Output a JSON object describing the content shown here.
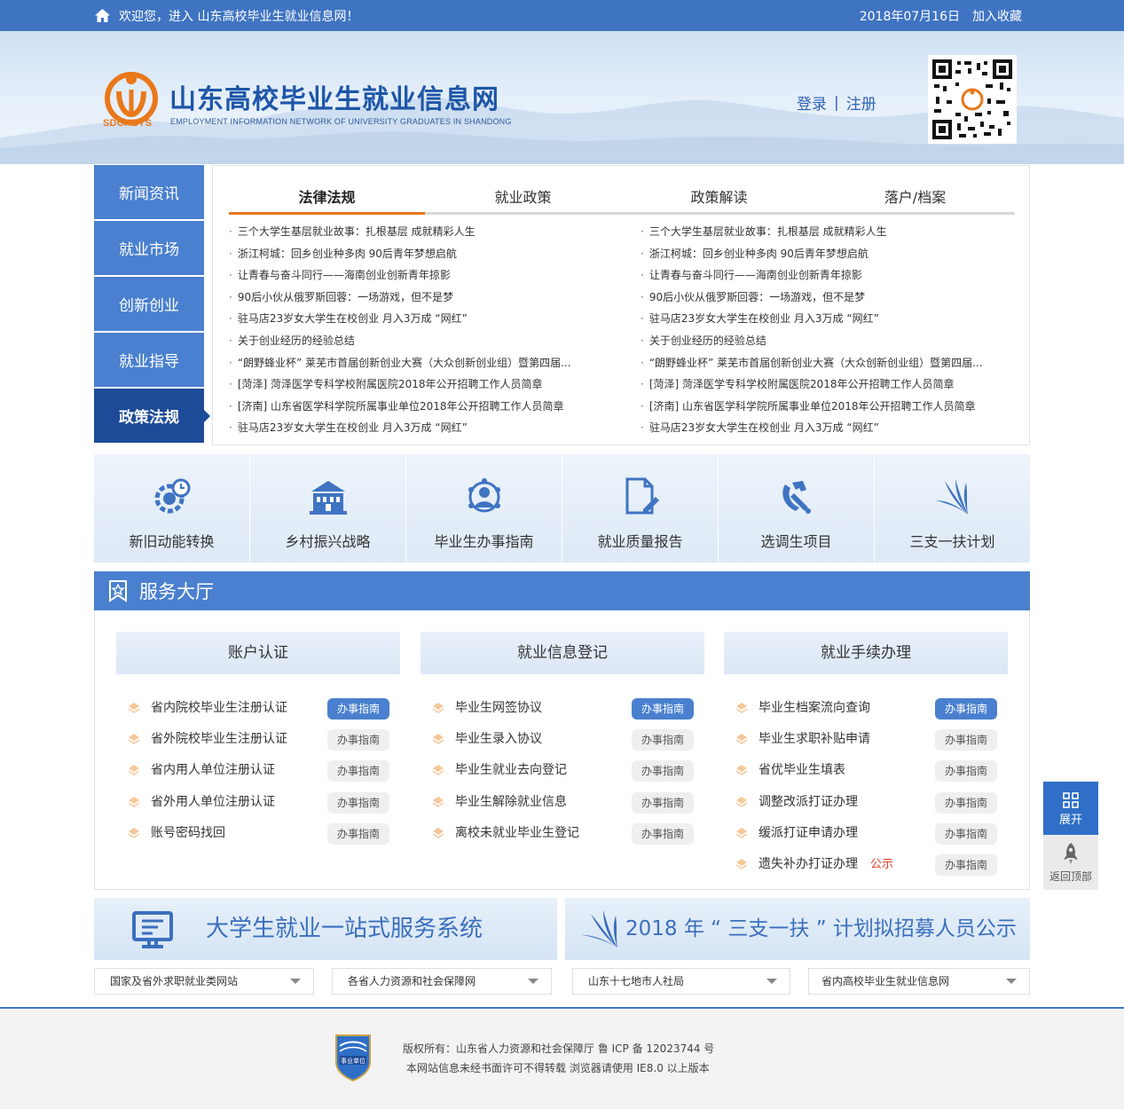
{
  "topbar": {
    "welcome": "欢迎您，进入 山东高校毕业生就业信息网！",
    "date": "2018年07月16日",
    "favorite": "加入收藏"
  },
  "header": {
    "logo_abbr": "SDGXBYS",
    "title": "山东高校毕业生就业信息网",
    "subtitle": "EMPLOYMENT INFORMATION NETWORK OF UNIVERSITY GRADUATES IN SHANDONG",
    "login": "登录",
    "separator": "|",
    "register": "注册"
  },
  "sidenav": [
    {
      "label": "新闻资讯"
    },
    {
      "label": "就业市场"
    },
    {
      "label": "创新创业"
    },
    {
      "label": "就业指导"
    },
    {
      "label": "政策法规",
      "active": true
    }
  ],
  "news": {
    "tabs": [
      "法律法规",
      "就业政策",
      "政策解读",
      "落户/档案"
    ],
    "active_tab": 0,
    "left": [
      "三个大学生基层就业故事：扎根基层 成就精彩人生",
      "浙江柯城：回乡创业种多肉 90后青年梦想启航",
      "让青春与奋斗同行——海南创业创新青年掠影",
      "90后小伙从俄罗斯回蓉：一场游戏，但不是梦",
      "驻马店23岁女大学生在校创业 月入3万成 “网红”",
      "关于创业经历的经验总结",
      "“朗野蜂业杯” 莱芜市首届创新创业大赛（大众创新创业组）暨第四届...",
      "[菏泽] 菏泽医学专科学校附属医院2018年公开招聘工作人员简章",
      "[济南] 山东省医学科学院所属事业单位2018年公开招聘工作人员简章",
      "驻马店23岁女大学生在校创业 月入3万成 “网红”"
    ],
    "right": [
      "三个大学生基层就业故事：扎根基层 成就精彩人生",
      "浙江柯城：回乡创业种多肉 90后青年梦想启航",
      "让青春与奋斗同行——海南创业创新青年掠影",
      "90后小伙从俄罗斯回蓉：一场游戏，但不是梦",
      "驻马店23岁女大学生在校创业 月入3万成 “网红”",
      "关于创业经历的经验总结",
      "“朗野蜂业杯” 莱芜市首届创新创业大赛（大众创新创业组）暨第四届...",
      "[菏泽] 菏泽医学专科学校附属医院2018年公开招聘工作人员简章",
      "[济南] 山东省医学科学院所属事业单位2018年公开招聘工作人员简章",
      "驻马店23岁女大学生在校创业 月入3万成 “网红”"
    ]
  },
  "quick_links": [
    {
      "label": "新旧动能转换",
      "icon": "gear-clock-icon"
    },
    {
      "label": "乡村振兴战略",
      "icon": "building-icon"
    },
    {
      "label": "毕业生办事指南",
      "icon": "people-network-icon"
    },
    {
      "label": "就业质量报告",
      "icon": "document-edit-icon"
    },
    {
      "label": "选调生项目",
      "icon": "party-emblem-icon"
    },
    {
      "label": "三支一扶计划",
      "icon": "leaf-fan-icon"
    }
  ],
  "hall": {
    "title": "服务大厅",
    "guide_label": "办事指南",
    "notice_label": "公示",
    "columns": [
      {
        "title": "账户认证",
        "items": [
          "省内院校毕业生注册认证",
          "省外院校毕业生注册认证",
          "省内用人单位注册认证",
          "省外用人单位注册认证",
          "账号密码找回"
        ]
      },
      {
        "title": "就业信息登记",
        "items": [
          "毕业生网签协议",
          "毕业生录入协议",
          "毕业生就业去向登记",
          "毕业生解除就业信息",
          "离校未就业毕业生登记"
        ]
      },
      {
        "title": "就业手续办理",
        "items": [
          "毕业生档案流向查询",
          "毕业生求职补贴申请",
          "省优毕业生填表",
          "调整改派打证办理",
          "缓派打证申请办理",
          "遗失补办打证办理"
        ]
      }
    ]
  },
  "banners": [
    {
      "text": "大学生就业一站式服务系统",
      "icon": "monitor-icon"
    },
    {
      "text": "2018 年 “ 三支一扶 ” 计划拟招募人员公示",
      "icon": "leaf-fan-icon"
    }
  ],
  "selects": [
    "国家及省外求职就业类网站",
    "各省人力资源和社会保障网",
    "山东十七地市人社局",
    "省内高校毕业生就业信息网"
  ],
  "footer": {
    "badge_text": "事业单位",
    "line1": "版权所有：山东省人力资源和社会保障厅   鲁 ICP 备 12023744 号",
    "line2": "本网站信息未经书面许可不得转载  浏览器请使用 IE8.0 以上版本"
  },
  "floating": {
    "expand": "展开",
    "back_top": "返回顶部"
  },
  "colors": {
    "primary": "#4a80cf",
    "dark": "#1d4b98",
    "accent": "#e8781a",
    "notice": "#e23c2c"
  }
}
